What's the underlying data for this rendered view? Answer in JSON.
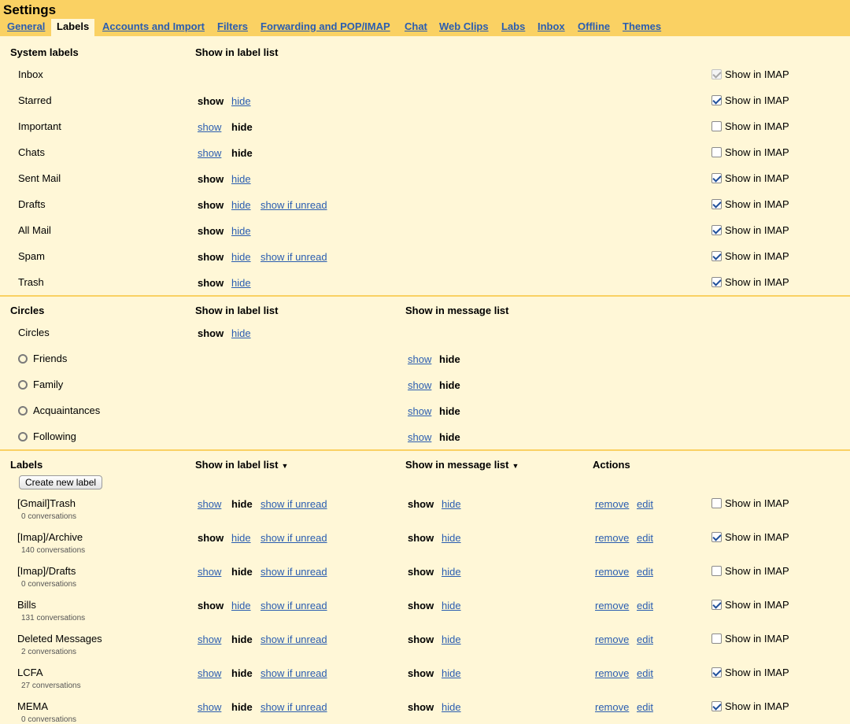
{
  "title": "Settings",
  "tabs": [
    "General",
    "Labels",
    "Accounts and Import",
    "Filters",
    "Forwarding and POP/IMAP",
    "Chat",
    "Web Clips",
    "Labs",
    "Inbox",
    "Offline",
    "Themes"
  ],
  "active_tab": "Labels",
  "common": {
    "show": "show",
    "hide": "hide",
    "show_if_unread": "show if unread",
    "remove": "remove",
    "edit": "edit",
    "show_in_imap": "Show in IMAP"
  },
  "system": {
    "heading": "System labels",
    "col_label_list": "Show in label list",
    "rows": [
      {
        "name": "Inbox",
        "options": [],
        "selected": "",
        "imap": true,
        "imap_disabled": true
      },
      {
        "name": "Starred",
        "options": [
          "show",
          "hide"
        ],
        "selected": "show",
        "imap": true
      },
      {
        "name": "Important",
        "options": [
          "show",
          "hide"
        ],
        "selected": "hide",
        "imap": false
      },
      {
        "name": "Chats",
        "options": [
          "show",
          "hide"
        ],
        "selected": "hide",
        "imap": false
      },
      {
        "name": "Sent Mail",
        "options": [
          "show",
          "hide"
        ],
        "selected": "show",
        "imap": true
      },
      {
        "name": "Drafts",
        "options": [
          "show",
          "hide",
          "show if unread"
        ],
        "selected": "show",
        "imap": true
      },
      {
        "name": "All Mail",
        "options": [
          "show",
          "hide"
        ],
        "selected": "show",
        "imap": true
      },
      {
        "name": "Spam",
        "options": [
          "show",
          "hide",
          "show if unread"
        ],
        "selected": "show",
        "imap": true
      },
      {
        "name": "Trash",
        "options": [
          "show",
          "hide"
        ],
        "selected": "show",
        "imap": true
      }
    ]
  },
  "circles": {
    "heading": "Circles",
    "col_label_list": "Show in label list",
    "col_message_list": "Show in message list",
    "parent": {
      "name": "Circles",
      "options": [
        "show",
        "hide"
      ],
      "selected": "show"
    },
    "rows": [
      {
        "name": "Friends",
        "options": [
          "show",
          "hide"
        ],
        "selected": "hide"
      },
      {
        "name": "Family",
        "options": [
          "show",
          "hide"
        ],
        "selected": "hide"
      },
      {
        "name": "Acquaintances",
        "options": [
          "show",
          "hide"
        ],
        "selected": "hide"
      },
      {
        "name": "Following",
        "options": [
          "show",
          "hide"
        ],
        "selected": "hide"
      }
    ]
  },
  "labels": {
    "heading": "Labels",
    "col_label_list": "Show in label list",
    "col_message_list": "Show in message list",
    "col_actions": "Actions",
    "create_button": "Create new label",
    "sort_arrow": "▼",
    "rows": [
      {
        "name": "[Gmail]Trash",
        "count": "0 conversations",
        "label_sel": "hide",
        "msg_sel": "show",
        "imap": false
      },
      {
        "name": "[Imap]/Archive",
        "count": "140 conversations",
        "label_sel": "show",
        "msg_sel": "show",
        "imap": true
      },
      {
        "name": "[Imap]/Drafts",
        "count": "0 conversations",
        "label_sel": "hide",
        "msg_sel": "show",
        "imap": false
      },
      {
        "name": "Bills",
        "count": "131 conversations",
        "label_sel": "show",
        "msg_sel": "show",
        "imap": true
      },
      {
        "name": "Deleted Messages",
        "count": "2 conversations",
        "label_sel": "hide",
        "msg_sel": "show",
        "imap": false
      },
      {
        "name": "LCFA",
        "count": "27 conversations",
        "label_sel": "hide",
        "msg_sel": "show",
        "imap": true
      },
      {
        "name": "MEMA",
        "count": "0 conversations",
        "label_sel": "hide",
        "msg_sel": "show",
        "imap": true
      }
    ]
  }
}
